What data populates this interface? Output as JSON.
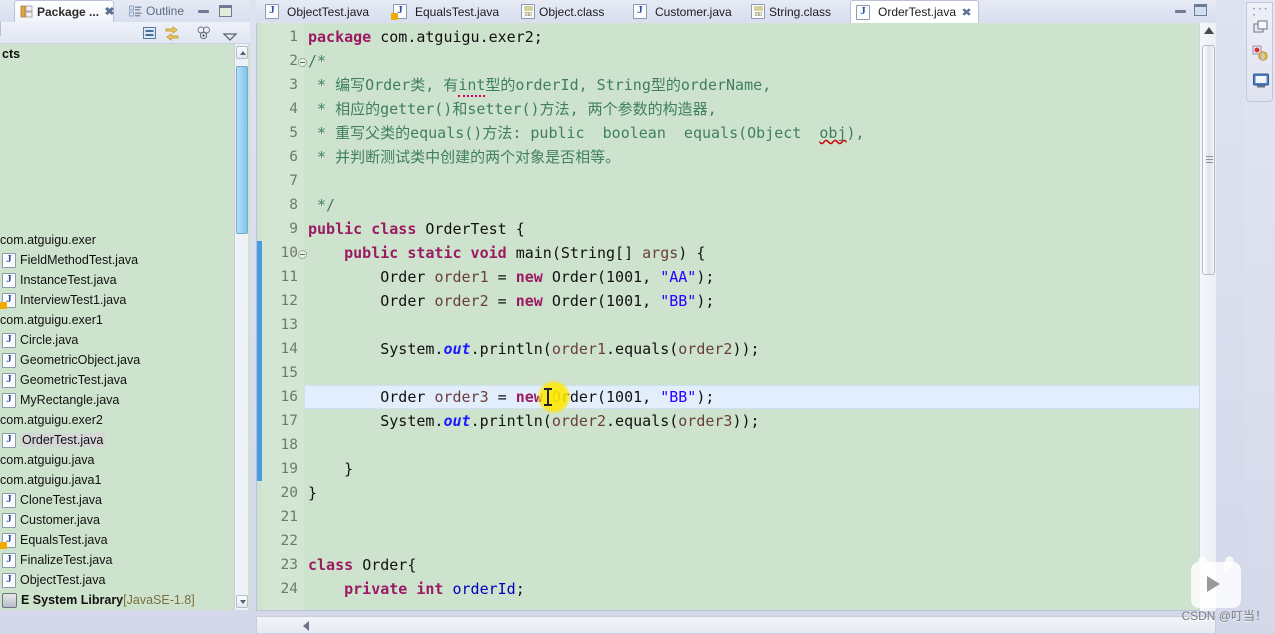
{
  "left_panel": {
    "tabs": [
      {
        "label": "Package ...",
        "icon": "package-explorer-icon",
        "active": true,
        "closable": true
      },
      {
        "label": "Outline",
        "icon": "outline-icon",
        "active": false,
        "closable": false
      }
    ],
    "window_buttons": [
      {
        "name": "minimize",
        "glyph": "minimize-icon"
      },
      {
        "name": "maximize",
        "glyph": "maximize-icon"
      }
    ],
    "toolbar_icons": [
      {
        "name": "collapse-all-icon",
        "title": "Collapse All"
      },
      {
        "name": "link-with-editor-icon",
        "title": "Link with Editor"
      },
      {
        "name": "view-filters-icon",
        "title": "Filters"
      },
      {
        "name": "view-menu-icon",
        "title": "View Menu"
      }
    ],
    "tree_top_label": "cts",
    "tree": [
      {
        "type": "package",
        "label": "com.atguigu.exer"
      },
      {
        "type": "file",
        "label": "FieldMethodTest.java",
        "warn": false
      },
      {
        "type": "file",
        "label": "InstanceTest.java",
        "warn": false
      },
      {
        "type": "file",
        "label": "InterviewTest1.java",
        "warn": true
      },
      {
        "type": "package",
        "label": "com.atguigu.exer1"
      },
      {
        "type": "file",
        "label": "Circle.java",
        "warn": false
      },
      {
        "type": "file",
        "label": "GeometricObject.java",
        "warn": false
      },
      {
        "type": "file",
        "label": "GeometricTest.java",
        "warn": false
      },
      {
        "type": "file",
        "label": "MyRectangle.java",
        "warn": false
      },
      {
        "type": "package",
        "label": "com.atguigu.exer2"
      },
      {
        "type": "file",
        "label": "OrderTest.java",
        "warn": false,
        "selected": true
      },
      {
        "type": "package",
        "label": "com.atguigu.java"
      },
      {
        "type": "package",
        "label": "com.atguigu.java1"
      },
      {
        "type": "file",
        "label": "CloneTest.java",
        "warn": false
      },
      {
        "type": "file",
        "label": "Customer.java",
        "warn": false
      },
      {
        "type": "file",
        "label": "EqualsTest.java",
        "warn": true
      },
      {
        "type": "file",
        "label": "FinalizeTest.java",
        "warn": false
      },
      {
        "type": "file",
        "label": "ObjectTest.java",
        "warn": false
      },
      {
        "type": "library",
        "label": "E System Library",
        "detail": "[JavaSE-1.8]"
      }
    ]
  },
  "editor": {
    "tabs": [
      {
        "label": "ObjectTest.java",
        "icon": "java-file-icon",
        "active": false,
        "warn": false
      },
      {
        "label": "EqualsTest.java",
        "icon": "java-file-icon",
        "active": false,
        "warn": true
      },
      {
        "label": "Object.class",
        "icon": "class-file-icon",
        "active": false,
        "warn": false
      },
      {
        "label": "Customer.java",
        "icon": "java-file-icon",
        "active": false,
        "warn": false
      },
      {
        "label": "String.class",
        "icon": "class-file-icon",
        "active": false,
        "warn": false
      },
      {
        "label": "OrderTest.java",
        "icon": "java-file-icon",
        "active": true,
        "warn": false,
        "closable": true
      }
    ],
    "window_buttons": [
      {
        "name": "minimize",
        "glyph": "minimize-icon"
      },
      {
        "name": "maximize",
        "glyph": "maximize-icon"
      }
    ],
    "current_line": 16,
    "first_visible_line": 1,
    "changed_line_range": [
      10,
      19
    ],
    "lines": [
      {
        "n": 1,
        "fold": false,
        "tokens": [
          {
            "t": "package ",
            "c": "kw"
          },
          {
            "t": "com.atguigu.exer2;",
            "c": "plain"
          }
        ]
      },
      {
        "n": 2,
        "fold": true,
        "tokens": [
          {
            "t": "/*",
            "c": "cmt"
          }
        ]
      },
      {
        "n": 3,
        "fold": false,
        "tokens": [
          {
            "t": " * 编写Order类, 有",
            "c": "cmt"
          },
          {
            "t": "int",
            "c": "cmt spell"
          },
          {
            "t": "型的orderId, String型的orderName,",
            "c": "cmt"
          }
        ]
      },
      {
        "n": 4,
        "fold": false,
        "tokens": [
          {
            "t": " * 相应的getter()和setter()方法, 两个参数的构造器,",
            "c": "cmt"
          }
        ]
      },
      {
        "n": 5,
        "fold": false,
        "tokens": [
          {
            "t": " * 重写父类的equals()方法: public  boolean  equals(Object  ",
            "c": "cmt"
          },
          {
            "t": "obj",
            "c": "cmt err"
          },
          {
            "t": "),",
            "c": "cmt"
          }
        ]
      },
      {
        "n": 6,
        "fold": false,
        "tokens": [
          {
            "t": " * 并判断测试类中创建的两个对象是否相等。",
            "c": "cmt"
          }
        ]
      },
      {
        "n": 7,
        "fold": false,
        "tokens": []
      },
      {
        "n": 8,
        "fold": false,
        "tokens": [
          {
            "t": " */",
            "c": "cmt"
          }
        ]
      },
      {
        "n": 9,
        "fold": false,
        "tokens": [
          {
            "t": "public class ",
            "c": "kw"
          },
          {
            "t": "OrderTest {",
            "c": "plain"
          }
        ]
      },
      {
        "n": 10,
        "fold": true,
        "tokens": [
          {
            "t": "    ",
            "c": "plain"
          },
          {
            "t": "public static void ",
            "c": "kw"
          },
          {
            "t": "main(String[] ",
            "c": "plain"
          },
          {
            "t": "args",
            "c": "param"
          },
          {
            "t": ") {",
            "c": "plain"
          }
        ]
      },
      {
        "n": 11,
        "fold": false,
        "tokens": [
          {
            "t": "        Order ",
            "c": "plain"
          },
          {
            "t": "order1",
            "c": "param"
          },
          {
            "t": " = ",
            "c": "plain"
          },
          {
            "t": "new ",
            "c": "kw"
          },
          {
            "t": "Order(",
            "c": "plain"
          },
          {
            "t": "1001",
            "c": "num"
          },
          {
            "t": ", ",
            "c": "plain"
          },
          {
            "t": "\"AA\"",
            "c": "str"
          },
          {
            "t": ");",
            "c": "plain"
          }
        ]
      },
      {
        "n": 12,
        "fold": false,
        "tokens": [
          {
            "t": "        Order ",
            "c": "plain"
          },
          {
            "t": "order2",
            "c": "param"
          },
          {
            "t": " = ",
            "c": "plain"
          },
          {
            "t": "new ",
            "c": "kw"
          },
          {
            "t": "Order(",
            "c": "plain"
          },
          {
            "t": "1001",
            "c": "num"
          },
          {
            "t": ", ",
            "c": "plain"
          },
          {
            "t": "\"BB\"",
            "c": "str"
          },
          {
            "t": ");",
            "c": "plain"
          }
        ]
      },
      {
        "n": 13,
        "fold": false,
        "tokens": []
      },
      {
        "n": 14,
        "fold": false,
        "tokens": [
          {
            "t": "        System.",
            "c": "plain"
          },
          {
            "t": "out",
            "c": "stat"
          },
          {
            "t": ".println(",
            "c": "plain"
          },
          {
            "t": "order1",
            "c": "param"
          },
          {
            "t": ".equals(",
            "c": "plain"
          },
          {
            "t": "order2",
            "c": "param"
          },
          {
            "t": "));",
            "c": "plain"
          }
        ]
      },
      {
        "n": 15,
        "fold": false,
        "tokens": []
      },
      {
        "n": 16,
        "fold": false,
        "tokens": [
          {
            "t": "        Order ",
            "c": "plain"
          },
          {
            "t": "order3",
            "c": "param"
          },
          {
            "t": " = ",
            "c": "plain"
          },
          {
            "t": "new ",
            "c": "kw"
          },
          {
            "t": "Order(",
            "c": "plain"
          },
          {
            "t": "1001",
            "c": "num"
          },
          {
            "t": ", ",
            "c": "plain"
          },
          {
            "t": "\"BB\"",
            "c": "str"
          },
          {
            "t": ");",
            "c": "plain"
          }
        ]
      },
      {
        "n": 17,
        "fold": false,
        "tokens": [
          {
            "t": "        System.",
            "c": "plain"
          },
          {
            "t": "out",
            "c": "stat"
          },
          {
            "t": ".println(",
            "c": "plain"
          },
          {
            "t": "order2",
            "c": "param"
          },
          {
            "t": ".equals(",
            "c": "plain"
          },
          {
            "t": "order3",
            "c": "param"
          },
          {
            "t": "));",
            "c": "plain"
          }
        ]
      },
      {
        "n": 18,
        "fold": false,
        "tokens": []
      },
      {
        "n": 19,
        "fold": false,
        "tokens": [
          {
            "t": "    }",
            "c": "plain"
          }
        ]
      },
      {
        "n": 20,
        "fold": false,
        "tokens": [
          {
            "t": "}",
            "c": "plain"
          }
        ]
      },
      {
        "n": 21,
        "fold": false,
        "tokens": []
      },
      {
        "n": 22,
        "fold": false,
        "tokens": []
      },
      {
        "n": 23,
        "fold": false,
        "tokens": [
          {
            "t": "class ",
            "c": "kw"
          },
          {
            "t": "Order{",
            "c": "plain"
          }
        ]
      },
      {
        "n": 24,
        "fold": false,
        "tokens": [
          {
            "t": "    ",
            "c": "plain"
          },
          {
            "t": "private int ",
            "c": "kw"
          },
          {
            "t": "orderId",
            "c": "fld"
          },
          {
            "t": ";",
            "c": "plain"
          }
        ]
      }
    ]
  },
  "right_bar": {
    "icons": [
      {
        "name": "restore-perspective-icon"
      },
      {
        "name": "java-ee-perspective-icon"
      },
      {
        "name": "java-perspective-icon"
      }
    ]
  },
  "watermark": {
    "text": "CSDN @叮当！",
    "logo": "csdn-tv-logo"
  },
  "colors": {
    "editor_bg": "#cde3cd",
    "gutter_bg": "#d3e6d3",
    "current_line": "#e2eefb",
    "changed_marker": "#4b9ae0",
    "keyword": "#9b1a63",
    "comment": "#3f7f5f",
    "string": "#2a00ff",
    "field": "#0000c0",
    "static_field": "#1a1aff",
    "param": "#6a3e3e",
    "cursor_highlight": "#ffe600"
  }
}
